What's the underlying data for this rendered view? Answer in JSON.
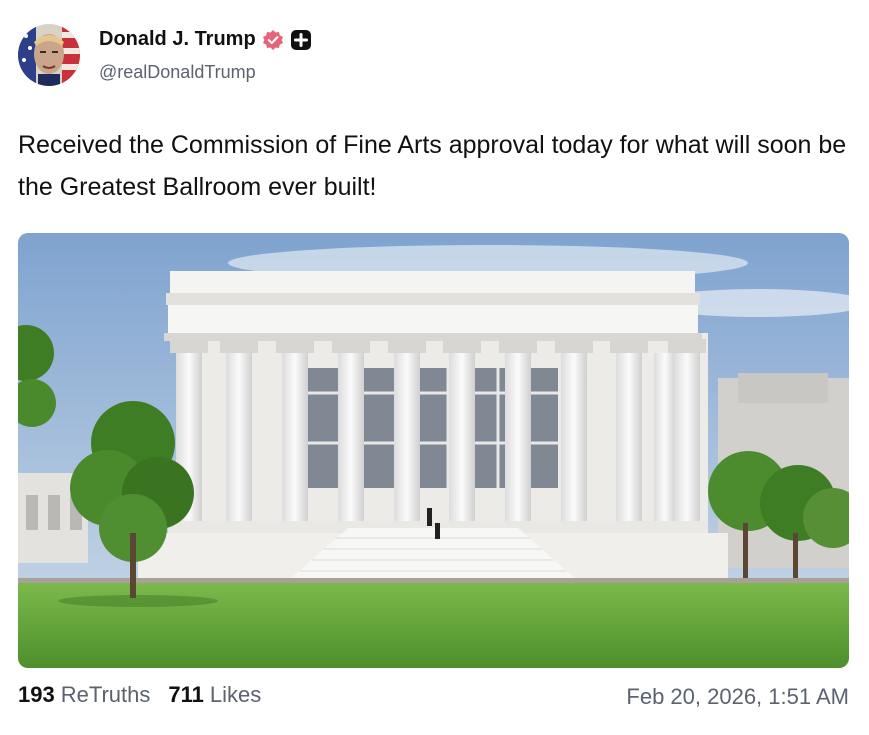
{
  "author": {
    "display_name": "Donald J. Trump",
    "handle": "@realDonaldTrump",
    "verified_icon": "verified-badge-icon",
    "badge_icon": "plus-badge-icon"
  },
  "post": {
    "text": "Received the Commission of Fine Arts approval today for what will soon be the Greatest Ballroom ever built!",
    "image_alt": "ballroom-rendering"
  },
  "stats": {
    "retruths_count": "193",
    "retruths_label": "ReTruths",
    "likes_count": "711",
    "likes_label": "Likes"
  },
  "timestamp": "Feb 20, 2026, 1:51 AM",
  "colors": {
    "text": "#111111",
    "muted": "#5b6270",
    "verified": "#e8627a"
  }
}
